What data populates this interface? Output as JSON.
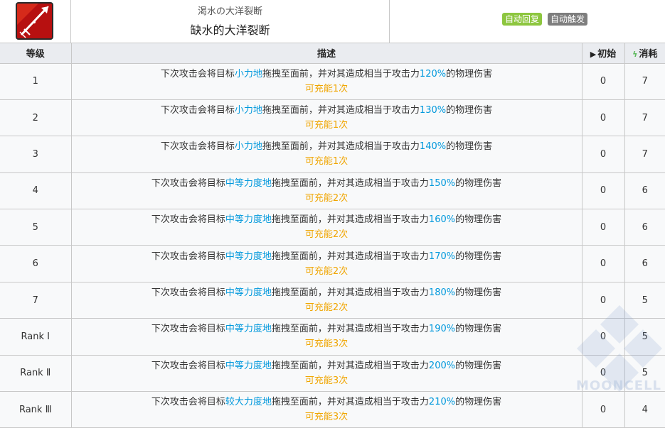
{
  "skill": {
    "name_jp": "渇水の大洋裂断",
    "name_cn": "缺水的大洋裂断",
    "tags": [
      "自动回复",
      "自动触发"
    ]
  },
  "table": {
    "headers": {
      "level": "等级",
      "description": "描述",
      "initial": "初始",
      "cost": "消耗"
    },
    "rows": [
      {
        "level": "1",
        "pre": "下次攻击会将目标",
        "force": "小力地",
        "mid": "拖拽至面前，并对其造成相当于攻击力",
        "pct": "120%",
        "post": "的物理伤害",
        "charge": "可充能1次",
        "initial": "0",
        "cost": "7"
      },
      {
        "level": "2",
        "pre": "下次攻击会将目标",
        "force": "小力地",
        "mid": "拖拽至面前，并对其造成相当于攻击力",
        "pct": "130%",
        "post": "的物理伤害",
        "charge": "可充能1次",
        "initial": "0",
        "cost": "7"
      },
      {
        "level": "3",
        "pre": "下次攻击会将目标",
        "force": "小力地",
        "mid": "拖拽至面前，并对其造成相当于攻击力",
        "pct": "140%",
        "post": "的物理伤害",
        "charge": "可充能1次",
        "initial": "0",
        "cost": "7"
      },
      {
        "level": "4",
        "pre": "下次攻击会将目标",
        "force": "中等力度地",
        "mid": "拖拽至面前，并对其造成相当于攻击力",
        "pct": "150%",
        "post": "的物理伤害",
        "charge": "可充能2次",
        "initial": "0",
        "cost": "6"
      },
      {
        "level": "5",
        "pre": "下次攻击会将目标",
        "force": "中等力度地",
        "mid": "拖拽至面前，并对其造成相当于攻击力",
        "pct": "160%",
        "post": "的物理伤害",
        "charge": "可充能2次",
        "initial": "0",
        "cost": "6"
      },
      {
        "level": "6",
        "pre": "下次攻击会将目标",
        "force": "中等力度地",
        "mid": "拖拽至面前，并对其造成相当于攻击力",
        "pct": "170%",
        "post": "的物理伤害",
        "charge": "可充能2次",
        "initial": "0",
        "cost": "6"
      },
      {
        "level": "7",
        "pre": "下次攻击会将目标",
        "force": "中等力度地",
        "mid": "拖拽至面前，并对其造成相当于攻击力",
        "pct": "180%",
        "post": "的物理伤害",
        "charge": "可充能2次",
        "initial": "0",
        "cost": "5"
      },
      {
        "level": "Rank Ⅰ",
        "pre": "下次攻击会将目标",
        "force": "中等力度地",
        "mid": "拖拽至面前，并对其造成相当于攻击力",
        "pct": "190%",
        "post": "的物理伤害",
        "charge": "可充能3次",
        "initial": "0",
        "cost": "5"
      },
      {
        "level": "Rank Ⅱ",
        "pre": "下次攻击会将目标",
        "force": "中等力度地",
        "mid": "拖拽至面前，并对其造成相当于攻击力",
        "pct": "200%",
        "post": "的物理伤害",
        "charge": "可充能3次",
        "initial": "0",
        "cost": "5"
      },
      {
        "level": "Rank Ⅲ",
        "pre": "下次攻击会将目标",
        "force": "较大力度地",
        "mid": "拖拽至面前，并对其造成相当于攻击力",
        "pct": "210%",
        "post": "的物理伤害",
        "charge": "可充能3次",
        "initial": "0",
        "cost": "4"
      }
    ]
  },
  "watermark": "MOONCELL",
  "colors": {
    "highlight": "#0098dc",
    "charge": "#f0a500",
    "tag_auto_recover": "#8dc63f",
    "tag_auto_trigger": "#7e7e7e",
    "header_bg": "#eaecf0",
    "icon_red": "#b71010"
  },
  "icons": {
    "skill": "harpoon-skill-icon",
    "initial": "play-triangle-icon",
    "cost": "lightning-bolt-icon"
  }
}
